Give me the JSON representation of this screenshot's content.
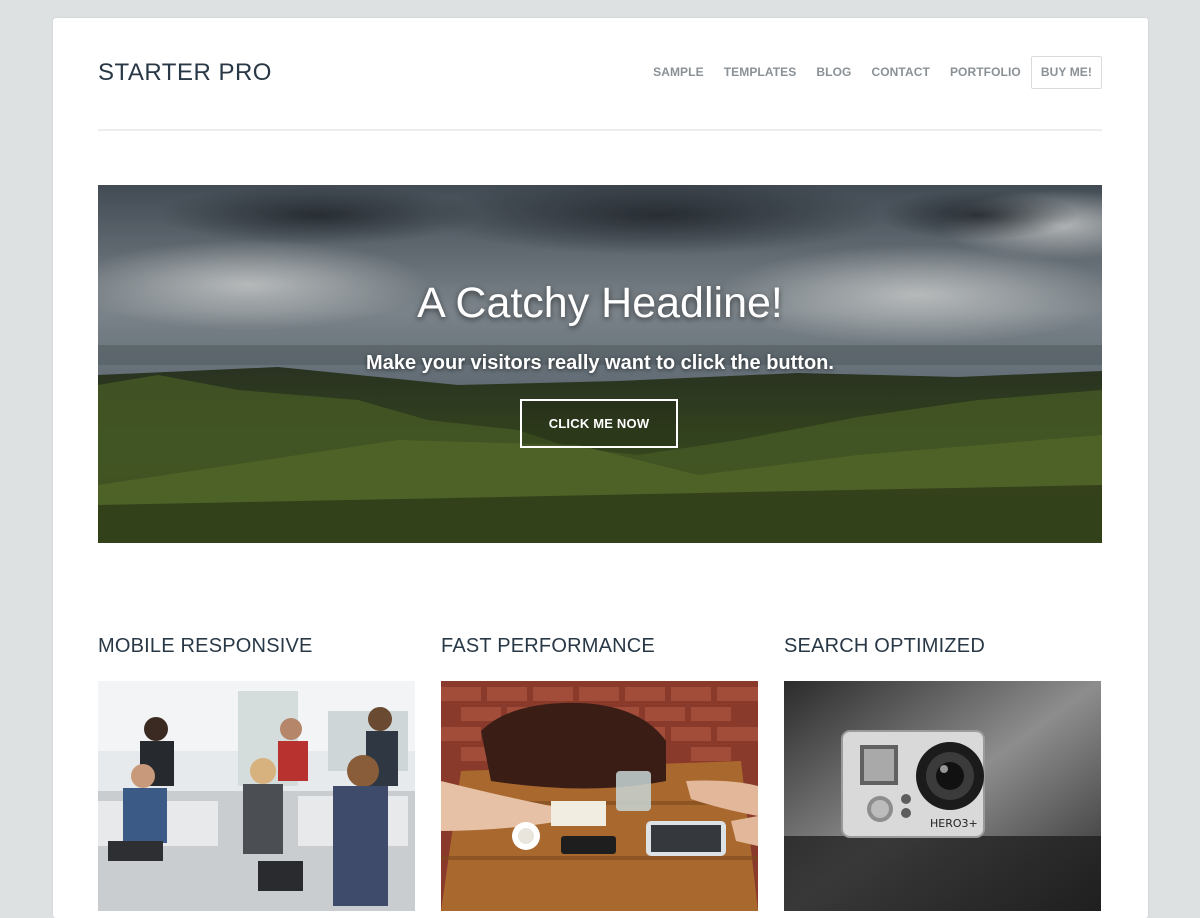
{
  "site": {
    "logo": "STARTER PRO"
  },
  "nav": {
    "items": [
      {
        "label": "SAMPLE"
      },
      {
        "label": "TEMPLATES"
      },
      {
        "label": "BLOG"
      },
      {
        "label": "CONTACT"
      },
      {
        "label": "PORTFOLIO"
      }
    ],
    "cta_label": "BUY ME!"
  },
  "hero": {
    "title": "A Catchy Headline!",
    "subtitle": "Make your visitors really want to click the button.",
    "button_label": "CLICK ME NOW"
  },
  "features": [
    {
      "title": "MOBILE RESPONSIVE"
    },
    {
      "title": "FAST PERFORMANCE"
    },
    {
      "title": "SEARCH OPTIMIZED"
    }
  ],
  "camera_brand": "HERO3+",
  "colors": {
    "page_background": "#dde1e1",
    "heading": "#283846",
    "nav_text": "#8a9196"
  }
}
